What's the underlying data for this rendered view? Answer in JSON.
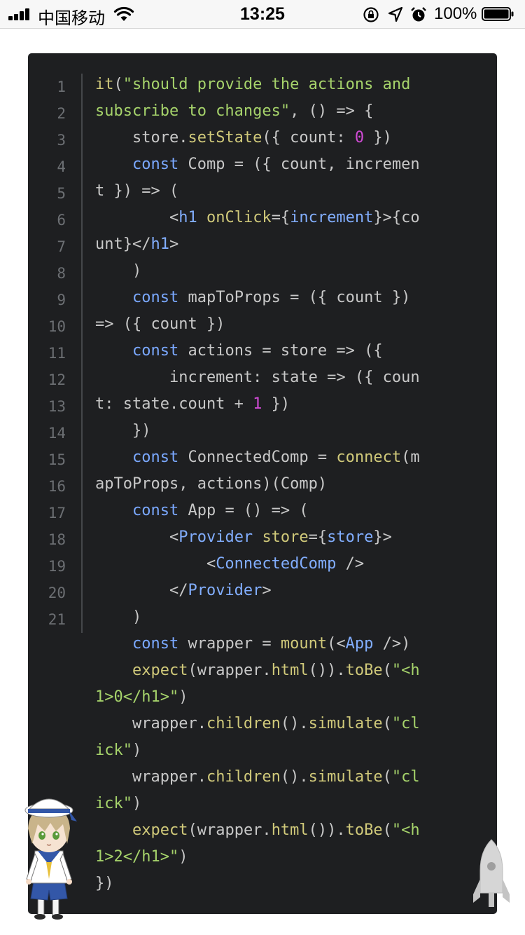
{
  "status_bar": {
    "carrier": "中国移动",
    "time": "13:25",
    "battery_percent": "100%",
    "battery_level": 1.0,
    "icons": [
      "signal-icon",
      "wifi-icon",
      "orientation-lock-icon",
      "location-icon",
      "alarm-icon",
      "battery-icon"
    ]
  },
  "code_block": {
    "line_numbers": [
      "1",
      "2",
      "3",
      "4",
      "5",
      "6",
      "7",
      "8",
      "9",
      "10",
      "11",
      "12",
      "13",
      "14",
      "15",
      "16",
      "17",
      "18",
      "19",
      "20",
      "21"
    ],
    "lines": [
      [
        [
          "f",
          "it"
        ],
        [
          "p",
          "("
        ],
        [
          "s",
          "\"should provide the actions and"
        ]
      ],
      [
        [
          "s",
          "subscribe to changes\""
        ],
        [
          "p",
          ", () => {"
        ]
      ],
      [
        [
          "p",
          "    store."
        ],
        [
          "f",
          "setState"
        ],
        [
          "p",
          "({ count: "
        ],
        [
          "n",
          "0"
        ],
        [
          "p",
          " })"
        ]
      ],
      [
        [
          "p",
          "    "
        ],
        [
          "k",
          "const"
        ],
        [
          "p",
          " Comp = ({ count, incremen"
        ]
      ],
      [
        [
          "p",
          "t }) => ("
        ]
      ],
      [
        [
          "p",
          "        <"
        ],
        [
          "t",
          "h1"
        ],
        [
          "p",
          " "
        ],
        [
          "f",
          "onClick"
        ],
        [
          "p",
          "={"
        ],
        [
          "t",
          "increment"
        ],
        [
          "p",
          "}>{co"
        ]
      ],
      [
        [
          "p",
          "unt}</"
        ],
        [
          "t",
          "h1"
        ],
        [
          "p",
          ">"
        ]
      ],
      [
        [
          "p",
          "    )"
        ]
      ],
      [
        [
          "p",
          "    "
        ],
        [
          "k",
          "const"
        ],
        [
          "p",
          " mapToProps = ({ count })"
        ]
      ],
      [
        [
          "p",
          "=> ({ count })"
        ]
      ],
      [
        [
          "p",
          "    "
        ],
        [
          "k",
          "const"
        ],
        [
          "p",
          " actions = store => ({"
        ]
      ],
      [
        [
          "p",
          "        increment: state => ({ coun"
        ]
      ],
      [
        [
          "p",
          "t: state.count + "
        ],
        [
          "n",
          "1"
        ],
        [
          "p",
          " })"
        ]
      ],
      [
        [
          "p",
          "    })"
        ]
      ],
      [
        [
          "p",
          "    "
        ],
        [
          "k",
          "const"
        ],
        [
          "p",
          " ConnectedComp = "
        ],
        [
          "f",
          "connect"
        ],
        [
          "p",
          "(m"
        ]
      ],
      [
        [
          "p",
          "apToProps, actions)(Comp)"
        ]
      ],
      [
        [
          "p",
          "    "
        ],
        [
          "k",
          "const"
        ],
        [
          "p",
          " App = () => ("
        ]
      ],
      [
        [
          "p",
          "        <"
        ],
        [
          "t",
          "Provider"
        ],
        [
          "p",
          " "
        ],
        [
          "f",
          "store"
        ],
        [
          "p",
          "={"
        ],
        [
          "t",
          "store"
        ],
        [
          "p",
          "}>"
        ]
      ],
      [
        [
          "p",
          "            <"
        ],
        [
          "t",
          "ConnectedComp"
        ],
        [
          "p",
          " />"
        ]
      ],
      [
        [
          "p",
          "        </"
        ],
        [
          "t",
          "Provider"
        ],
        [
          "p",
          ">"
        ]
      ],
      [
        [
          "p",
          "    )"
        ]
      ],
      [
        [
          "p",
          "    "
        ],
        [
          "k",
          "const"
        ],
        [
          "p",
          " wrapper = "
        ],
        [
          "f",
          "mount"
        ],
        [
          "p",
          "(<"
        ],
        [
          "t",
          "App"
        ],
        [
          "p",
          " />)"
        ]
      ],
      [
        [
          "p",
          "    "
        ],
        [
          "f",
          "expect"
        ],
        [
          "p",
          "(wrapper."
        ],
        [
          "f",
          "html"
        ],
        [
          "p",
          "())."
        ],
        [
          "f",
          "toBe"
        ],
        [
          "p",
          "("
        ],
        [
          "s",
          "\"<h"
        ]
      ],
      [
        [
          "s",
          "1>0</h1>\""
        ],
        [
          "p",
          ")"
        ]
      ],
      [
        [
          "p",
          "    wrapper."
        ],
        [
          "f",
          "children"
        ],
        [
          "p",
          "()."
        ],
        [
          "f",
          "simulate"
        ],
        [
          "p",
          "("
        ],
        [
          "s",
          "\"cl"
        ]
      ],
      [
        [
          "s",
          "ick\""
        ],
        [
          "p",
          ")"
        ]
      ],
      [
        [
          "p",
          "    wrapper."
        ],
        [
          "f",
          "children"
        ],
        [
          "p",
          "()."
        ],
        [
          "f",
          "simulate"
        ],
        [
          "p",
          "("
        ],
        [
          "s",
          "\"cl"
        ]
      ],
      [
        [
          "s",
          "ick\""
        ],
        [
          "p",
          ")"
        ]
      ],
      [
        [
          "p",
          "    "
        ],
        [
          "f",
          "expect"
        ],
        [
          "p",
          "(wrapper."
        ],
        [
          "f",
          "html"
        ],
        [
          "p",
          "())."
        ],
        [
          "f",
          "toBe"
        ],
        [
          "p",
          "("
        ],
        [
          "s",
          "\"<h"
        ]
      ],
      [
        [
          "s",
          "1>2</h1>\""
        ],
        [
          "p",
          ")"
        ]
      ],
      [
        [
          "p",
          "})"
        ]
      ]
    ]
  },
  "decorations": {
    "mascot": "sailor-mascot-icon",
    "back_to_top": "rocket-icon"
  }
}
